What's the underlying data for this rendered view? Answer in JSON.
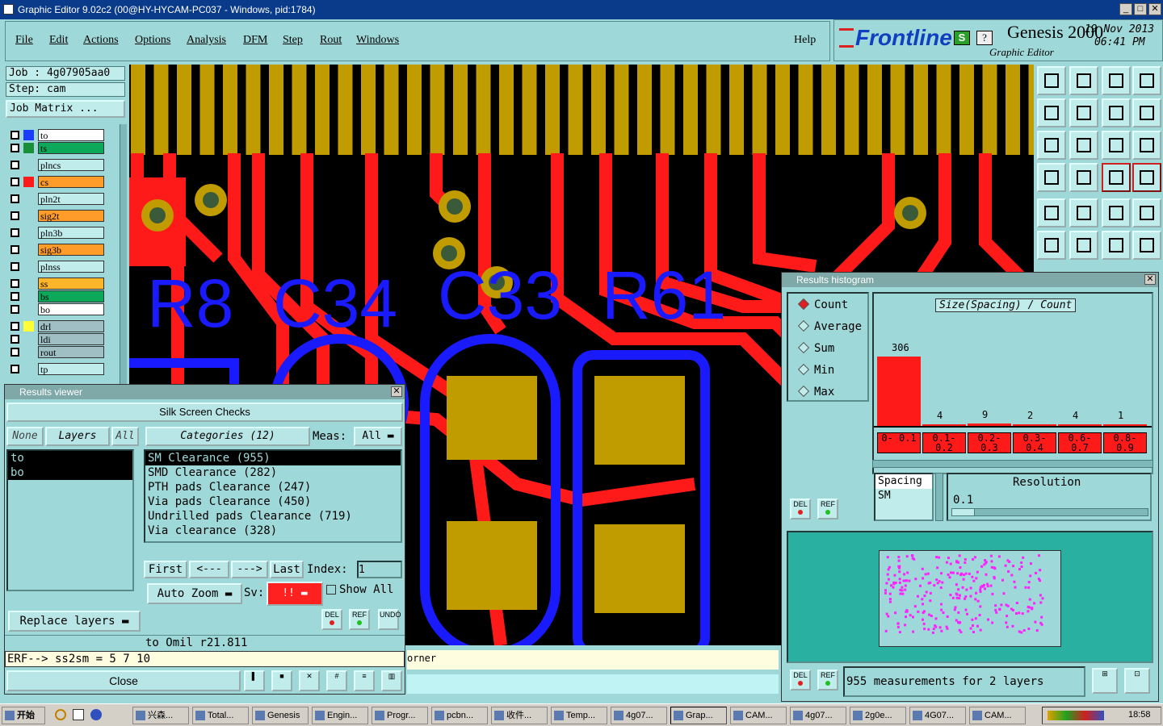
{
  "window": {
    "title": "Graphic Editor 9.02c2 (00@HY-HYCAM-PC037 - Windows, pid:1784)"
  },
  "menu": [
    "File",
    "Edit",
    "Actions",
    "Options",
    "Analysis",
    "DFM",
    "Step",
    "Rout",
    "Windows"
  ],
  "help": "Help",
  "brand": {
    "logo": "Frontline",
    "product": "Genesis 2000",
    "subtitle": "Graphic Editor",
    "date": "19 Nov 2013",
    "time": "06:41 PM",
    "s_label": "S",
    "q_label": "?"
  },
  "job": {
    "job": "Job : 4g07905aa0",
    "step": "Step: cam",
    "matrix_button": "Job Matrix ..."
  },
  "layers": [
    {
      "name": "to",
      "color": "#ffffff",
      "swatch": "#1a3cff"
    },
    {
      "name": "ts",
      "color": "#0ea85a",
      "swatch": "#1a8f3a"
    },
    {
      "name": "plncs",
      "color": "#c0ecec",
      "swatch": ""
    },
    {
      "name": "cs",
      "color": "#ff9c2a",
      "swatch": "#ff1a1a"
    },
    {
      "name": "pln2t",
      "color": "#c0ecec",
      "swatch": ""
    },
    {
      "name": "sig2t",
      "color": "#ff9c2a",
      "swatch": ""
    },
    {
      "name": "pln3b",
      "color": "#c0ecec",
      "swatch": ""
    },
    {
      "name": "sig3b",
      "color": "#ff9c2a",
      "swatch": ""
    },
    {
      "name": "plnss",
      "color": "#c0ecec",
      "swatch": ""
    },
    {
      "name": "ss",
      "color": "#ffb52a",
      "swatch": ""
    },
    {
      "name": "bs",
      "color": "#0ea85a",
      "swatch": ""
    },
    {
      "name": "bo",
      "color": "#ffffff",
      "swatch": ""
    },
    {
      "name": "drl",
      "color": "#9fbfc4",
      "swatch": "#ffff33"
    },
    {
      "name": "ldi",
      "color": "#9fbfc4",
      "swatch": ""
    },
    {
      "name": "rout",
      "color": "#9fbfc4",
      "swatch": ""
    },
    {
      "name": "tp",
      "color": "#c0ecec",
      "swatch": ""
    }
  ],
  "canvas_labels": [
    "R8",
    "C34",
    "C33",
    "R61"
  ],
  "results_viewer": {
    "title": "Results viewer",
    "header": "Silk Screen Checks",
    "btn_none": "None",
    "btn_layers": "Layers",
    "btn_all": "All",
    "layers": [
      "to",
      "bo"
    ],
    "categories_label": "Categories (12)",
    "meas_label": "Meas:",
    "meas_value": "All",
    "categories": [
      "SM Clearance (955)",
      "SMD Clearance (282)",
      "PTH pads Clearance (247)",
      "Via pads Clearance (450)",
      "Undrilled pads Clearance (719)",
      "Via clearance (328)"
    ],
    "nav": {
      "first": "First",
      "prev": "<---",
      "next": "--->",
      "last": "Last",
      "index_label": "Index:",
      "index_value": "1"
    },
    "auto_zoom": "Auto Zoom",
    "sv_label": "Sv:",
    "sv_value": "!!",
    "show_all": "Show All",
    "replace_layers": "Replace layers",
    "del": "DEL",
    "ref": "REF",
    "undo": "UNDO",
    "status": "to Omil  r21.811",
    "erf": "ERF--> ss2sm = 5 7 10",
    "corner_text": "orner",
    "close": "Close"
  },
  "histogram": {
    "title": "Results histogram",
    "options": [
      "Count",
      "Average",
      "Sum",
      "Min",
      "Max"
    ],
    "chart_title": "Size(Spacing) / Count",
    "bars": [
      {
        "range": "0- 0.1",
        "count": 306
      },
      {
        "range": "0.1- 0.2",
        "count": 4
      },
      {
        "range": "0.2- 0.3",
        "count": 9
      },
      {
        "range": "0.3- 0.4",
        "count": 2
      },
      {
        "range": "0.6- 0.7",
        "count": 4
      },
      {
        "range": "0.8- 0.9",
        "count": 1
      }
    ],
    "spacing_items": [
      "Spacing",
      "SM"
    ],
    "resolution_label": "Resolution",
    "resolution_value": "0.1",
    "summary": "955 measurements for 2 layers",
    "del": "DEL",
    "ref": "REF"
  },
  "taskbar": {
    "start": "开始",
    "items": [
      "兴森...",
      "Total...",
      "Genesis",
      "Engin...",
      "Progr...",
      "pcbn...",
      "收件...",
      "Temp...",
      "4g07...",
      "Grap...",
      "CAM...",
      "4g07...",
      "2g0e...",
      "4G07...",
      "CAM..."
    ],
    "clock": "18:58"
  }
}
